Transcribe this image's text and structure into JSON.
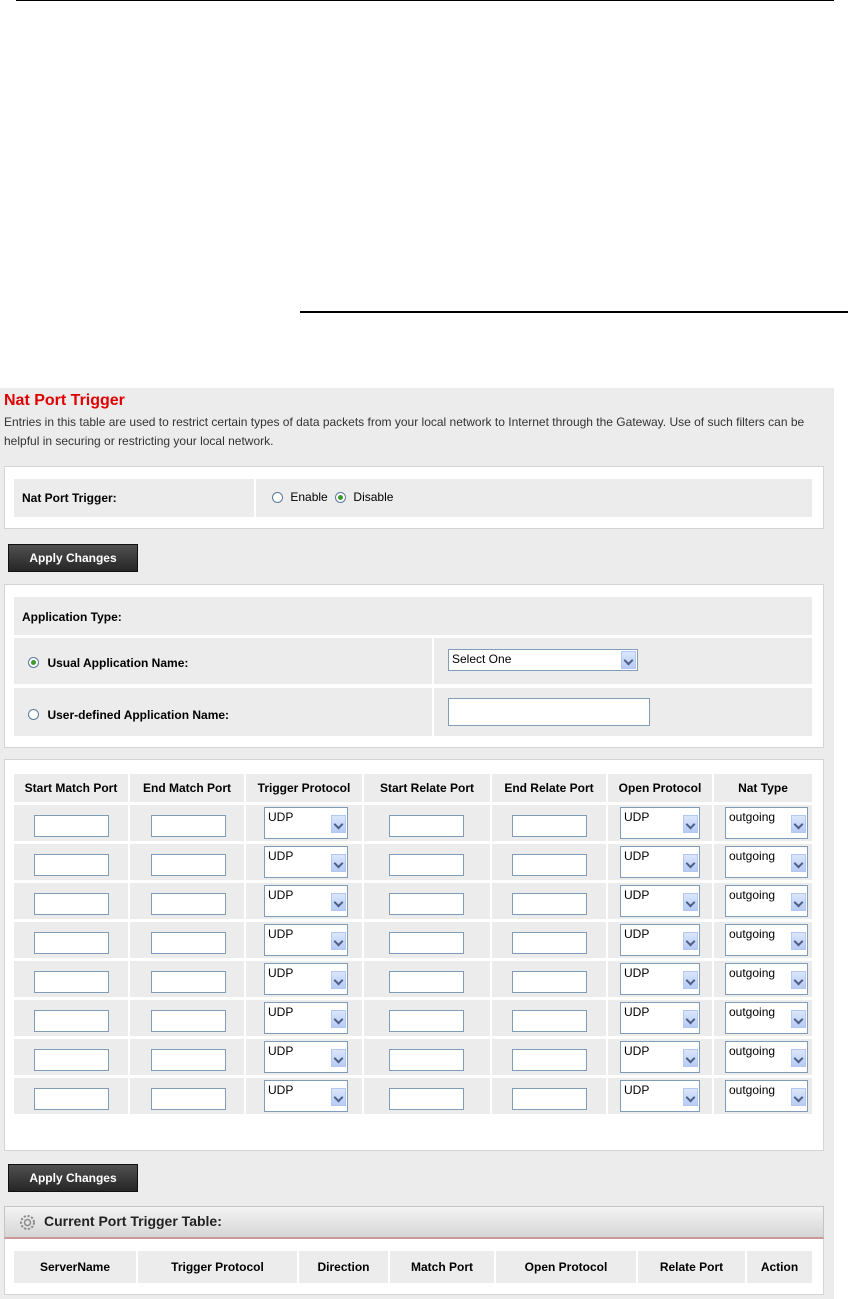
{
  "page": {
    "title": "Nat Port Trigger",
    "description": "Entries in this table are used to restrict certain types of data packets from your local network to Internet through the Gateway. Use of such filters can be helpful in securing or restricting your local network."
  },
  "trigger": {
    "label": "Nat Port Trigger:",
    "enable_label": "Enable",
    "disable_label": "Disable",
    "selected": "Disable"
  },
  "apply_label": "Apply Changes",
  "application": {
    "type_label": "Application Type:",
    "usual_label": "Usual Application Name:",
    "user_label": "User-defined Application Name:",
    "usual_selected": true,
    "select_value": "Select One",
    "user_value": ""
  },
  "port_table": {
    "headers": [
      "Start Match Port",
      "End Match Port",
      "Trigger Protocol",
      "Start Relate Port",
      "End Relate Port",
      "Open Protocol",
      "Nat Type"
    ],
    "rows": [
      {
        "trigger_protocol": "UDP",
        "open_protocol": "UDP",
        "nat_type": "outgoing"
      },
      {
        "trigger_protocol": "UDP",
        "open_protocol": "UDP",
        "nat_type": "outgoing"
      },
      {
        "trigger_protocol": "UDP",
        "open_protocol": "UDP",
        "nat_type": "outgoing"
      },
      {
        "trigger_protocol": "UDP",
        "open_protocol": "UDP",
        "nat_type": "outgoing"
      },
      {
        "trigger_protocol": "UDP",
        "open_protocol": "UDP",
        "nat_type": "outgoing"
      },
      {
        "trigger_protocol": "UDP",
        "open_protocol": "UDP",
        "nat_type": "outgoing"
      },
      {
        "trigger_protocol": "UDP",
        "open_protocol": "UDP",
        "nat_type": "outgoing"
      },
      {
        "trigger_protocol": "UDP",
        "open_protocol": "UDP",
        "nat_type": "outgoing"
      }
    ]
  },
  "current_table": {
    "title": "Current Port Trigger Table:",
    "headers": [
      "ServerName",
      "Trigger Protocol",
      "Direction",
      "Match Port",
      "Open Protocol",
      "Relate Port",
      "Action"
    ]
  },
  "colors": {
    "title": "#e00000",
    "panel": "#ececec",
    "button": "#333333"
  }
}
